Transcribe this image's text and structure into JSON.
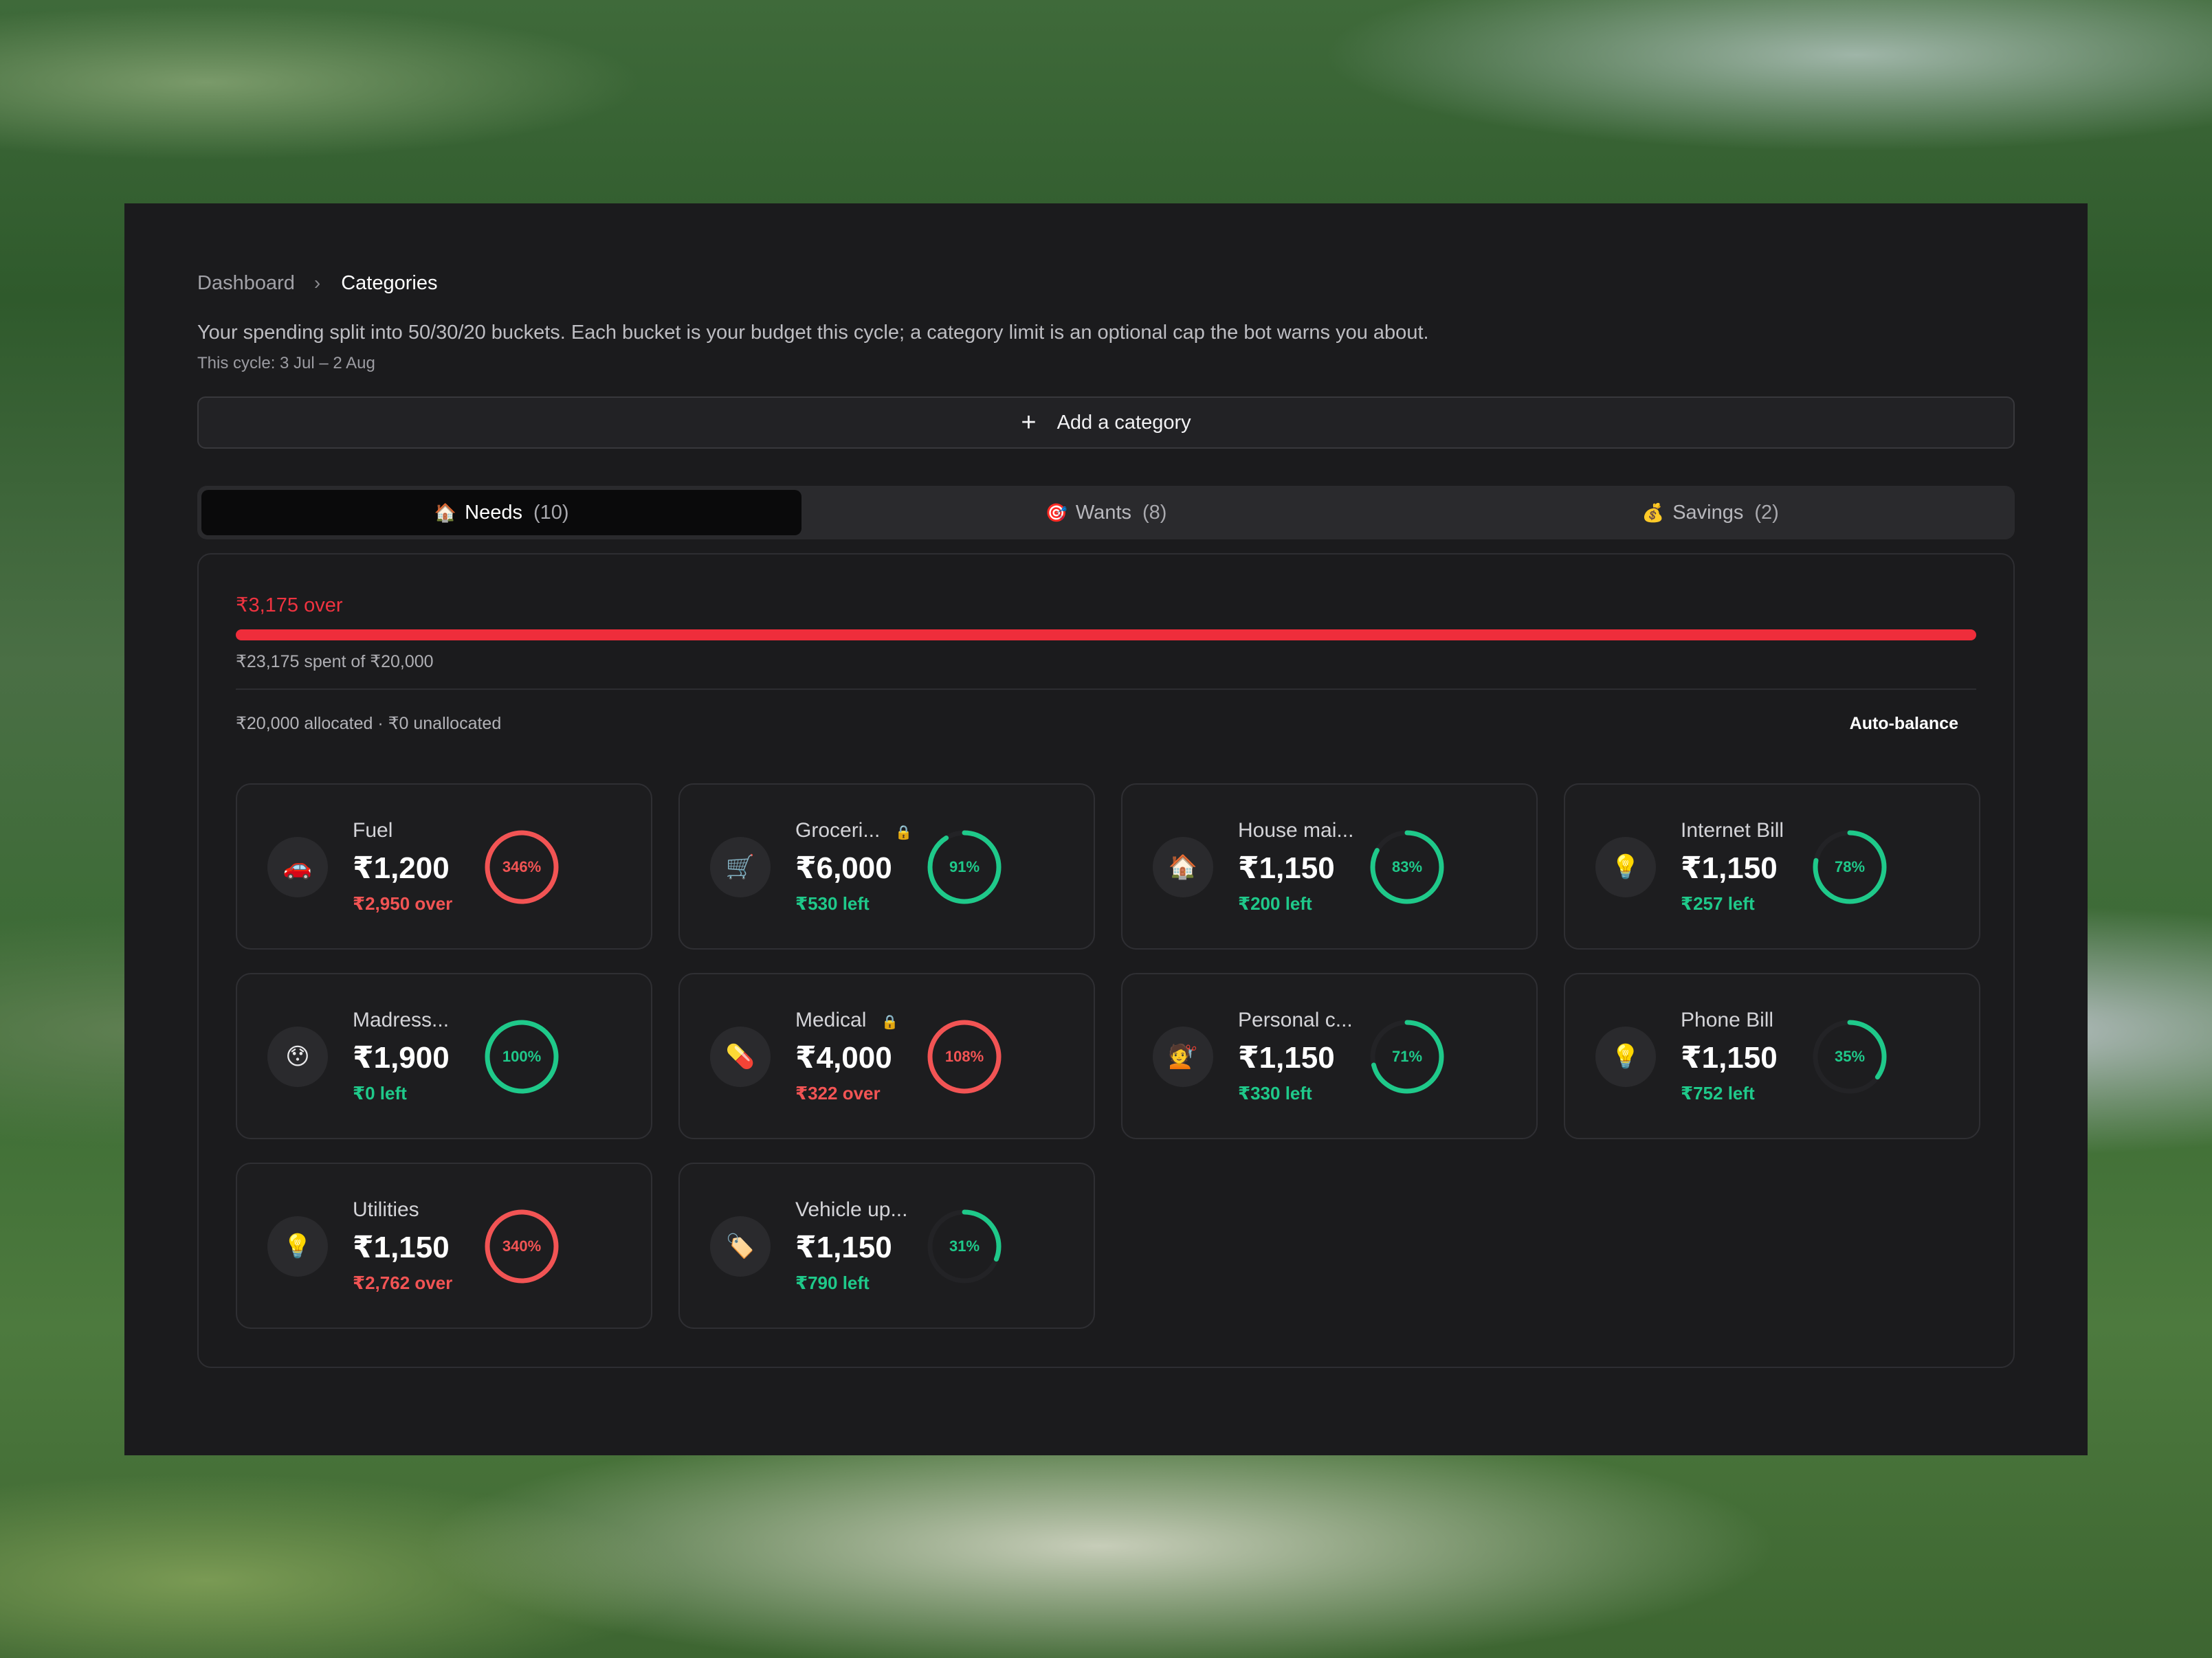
{
  "breadcrumb": {
    "root": "Dashboard",
    "separator": "›",
    "current": "Categories"
  },
  "description": "Your spending split into 50/30/20 buckets. Each bucket is your budget this cycle; a category limit is an optional cap the bot warns you about.",
  "cycle": "This cycle: 3 Jul – 2 Aug",
  "add_button": {
    "icon": "+",
    "label": "Add a category"
  },
  "tabs": [
    {
      "emoji": "🏠",
      "label": "Needs",
      "count": "(10)",
      "active": true
    },
    {
      "emoji": "🎯",
      "label": "Wants",
      "count": "(8)",
      "active": false
    },
    {
      "emoji": "💰",
      "label": "Savings",
      "count": "(2)",
      "active": false
    }
  ],
  "summary": {
    "over_label": "₹3,175 over",
    "spent_label": "₹23,175 spent of ₹20,000",
    "progress_fraction": 1.0,
    "allocation": "₹20,000 allocated · ₹0 unallocated",
    "auto_balance": "Auto-balance"
  },
  "colors": {
    "ok": "#1fc98a",
    "over": "#f25454",
    "bar": "#ef2d3b"
  },
  "categories": [
    {
      "emoji": "🚗",
      "name": "Fuel",
      "locked": false,
      "amount": "₹1,200",
      "status": "₹2,950 over",
      "over": true,
      "percent_label": "346%",
      "percent": 346
    },
    {
      "emoji": "🛒",
      "name": "Groceri...",
      "locked": true,
      "amount": "₹6,000",
      "status": "₹530 left",
      "over": false,
      "percent_label": "91%",
      "percent": 91
    },
    {
      "emoji": "🏠",
      "name": "House mai...",
      "locked": false,
      "amount": "₹1,150",
      "status": "₹200 left",
      "over": false,
      "percent_label": "83%",
      "percent": 83
    },
    {
      "emoji": "💡",
      "name": "Internet Bill",
      "locked": false,
      "amount": "₹1,150",
      "status": "₹257 left",
      "over": false,
      "percent_label": "78%",
      "percent": 78
    },
    {
      "emoji": "😯",
      "name": "Madress...",
      "locked": false,
      "amount": "₹1,900",
      "status": "₹0 left",
      "over": false,
      "percent_label": "100%",
      "percent": 100
    },
    {
      "emoji": "💊",
      "name": "Medical",
      "locked": true,
      "amount": "₹4,000",
      "status": "₹322 over",
      "over": true,
      "percent_label": "108%",
      "percent": 108
    },
    {
      "emoji": "💇",
      "name": "Personal c...",
      "locked": false,
      "amount": "₹1,150",
      "status": "₹330 left",
      "over": false,
      "percent_label": "71%",
      "percent": 71
    },
    {
      "emoji": "💡",
      "name": "Phone Bill",
      "locked": false,
      "amount": "₹1,150",
      "status": "₹752 left",
      "over": false,
      "percent_label": "35%",
      "percent": 35
    },
    {
      "emoji": "💡",
      "name": "Utilities",
      "locked": false,
      "amount": "₹1,150",
      "status": "₹2,762 over",
      "over": true,
      "percent_label": "340%",
      "percent": 340
    },
    {
      "emoji": "🏷️",
      "name": "Vehicle up...",
      "locked": false,
      "amount": "₹1,150",
      "status": "₹790 left",
      "over": false,
      "percent_label": "31%",
      "percent": 31
    }
  ],
  "lock_icon": "🔒"
}
